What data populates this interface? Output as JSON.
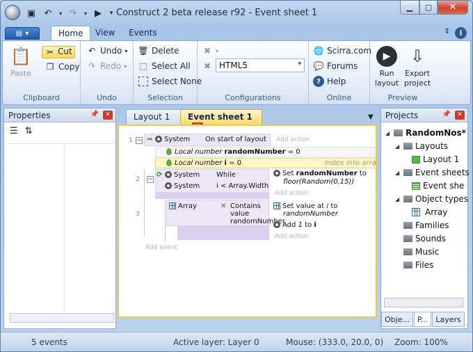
{
  "window": {
    "title": "Construct 2 beta release r92 - Event sheet 1"
  },
  "ribbon_tabs": [
    "Home",
    "View",
    "Events"
  ],
  "clipboard": {
    "paste": "Paste",
    "cut": "Cut",
    "copy": "Copy",
    "label": "Clipboard"
  },
  "undo": {
    "undo": "Undo",
    "redo": "Redo",
    "label": "Undo"
  },
  "selection": {
    "delete": "Delete",
    "select_all": "Select All",
    "select_none": "Select None",
    "label": "Selection"
  },
  "configurations": {
    "value": "HTML5",
    "label": "Configurations"
  },
  "online": {
    "scirra": "Scirra.com",
    "forums": "Forums",
    "help": "Help",
    "label": "Online"
  },
  "preview": {
    "run": "Run layout",
    "export": "Export project",
    "label": "Preview"
  },
  "properties": {
    "title": "Properties"
  },
  "doc_tabs": {
    "layout": "Layout 1",
    "events": "Event sheet 1"
  },
  "events": {
    "e1": {
      "num": "1",
      "object": "System",
      "condition": "On start of layout",
      "add_action": "Add action"
    },
    "var1": {
      "kind": "Local number",
      "name": "randomNumber",
      "value": "= 0"
    },
    "var2": {
      "kind": "Local number",
      "name": "i",
      "value": "= 0",
      "comment": "Index into array"
    },
    "e2": {
      "num": "2",
      "c1_obj": "System",
      "c1_text": "While",
      "c2_obj": "System",
      "c2_text": "i < Array.Width",
      "action_pre": "Set",
      "action_var": "randomNumber",
      "action_post": "to",
      "action_expr": "floor(Random(0,15))",
      "add_action": "Add action"
    },
    "e3": {
      "num": "3",
      "c_obj": "Array",
      "c_text": "Contains value randomNumber",
      "a1_pre": "Set value at",
      "a1_var": "i",
      "a1_post": "to",
      "a1_expr": "randomNumber",
      "a2_pre": "Add",
      "a2_num": "1",
      "a2_mid": "to",
      "a2_var": "i",
      "add_action": "Add action"
    },
    "add_event": "Add event"
  },
  "projects": {
    "title": "Projects",
    "root": "RandomNos*",
    "layouts": "Layouts",
    "layout1": "Layout 1",
    "event_sheets": "Event sheets",
    "event_sheet1": "Event she",
    "object_types": "Object types",
    "array": "Array",
    "families": "Families",
    "sounds": "Sounds",
    "music": "Music",
    "files": "Files",
    "tabs": [
      "Obje...",
      "P...",
      "Layers"
    ]
  },
  "status": {
    "events": "5 events",
    "layer": "Active layer: Layer 0",
    "mouse": "Mouse: (333.0, 20.0, 0)",
    "zoom": "Zoom: 100%"
  }
}
